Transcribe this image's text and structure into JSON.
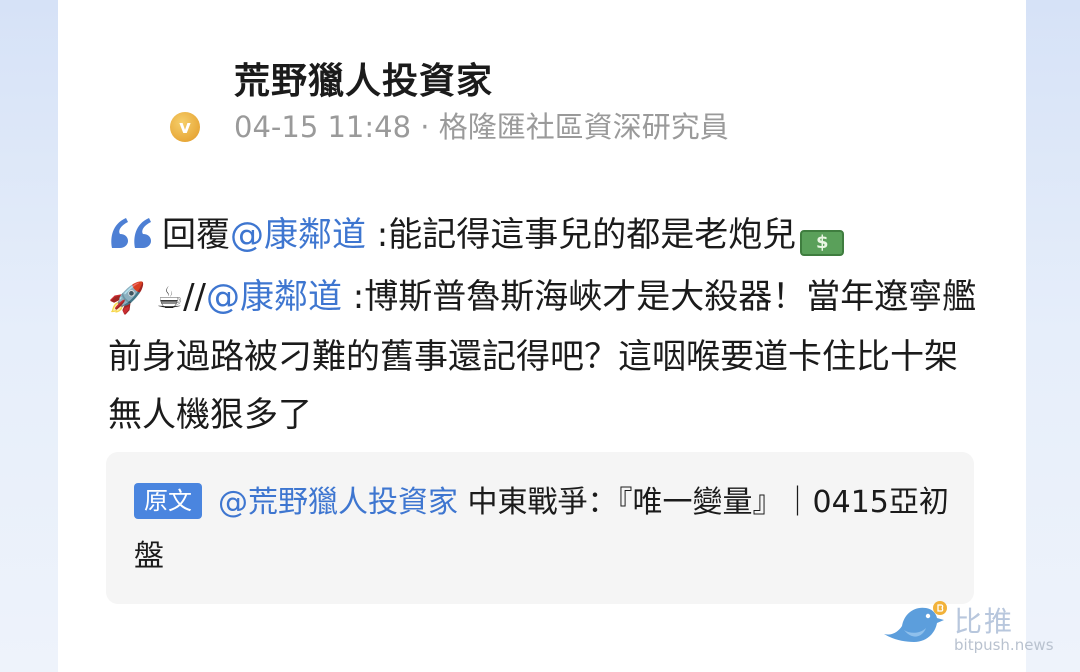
{
  "post": {
    "author_name": "荒野獵人投資家",
    "meta": "04-15 11:48 · 格隆匯社區資深研究員",
    "verified_glyph": "v",
    "reply_prefix": "回覆",
    "mention_1": "@康鄰道",
    "text_1": "  :能記得這事兒的都是老炮兒",
    "money_glyph": "$",
    "rocket_emoji": "🚀",
    "coffee_emoji": "☕",
    "repost_sep": "//",
    "mention_2": "@康鄰道",
    "text_2": "  :博斯普魯斯海峽才是大殺器！當年遼寧艦前身過路被刁難的舊事還記得吧？這咽喉要道卡住比十架無人機狠多了"
  },
  "original": {
    "tag": "原文",
    "mention": "@荒野獵人投資家",
    "text": " 中東戰爭：『唯一變量』｜0415亞初盤"
  },
  "watermark": {
    "name": "比推",
    "url": "bitpush.news"
  },
  "colors": {
    "mention": "#3e76d0",
    "tag_bg": "#4a85df",
    "badge": "#e8a93a"
  },
  "icons": {
    "quote": "quote-icon",
    "verified": "verified-badge-icon",
    "watermark": "bird-logo-icon"
  }
}
